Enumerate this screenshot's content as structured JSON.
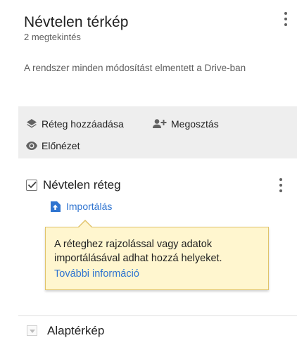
{
  "header": {
    "title": "Névtelen térkép",
    "views": "2 megtekintés",
    "save_status": "A rendszer minden módosítást elmentett a Drive-ban",
    "more_icon": "more-vert-icon"
  },
  "toolbar": {
    "add_layer_label": "Réteg hozzáadása",
    "add_layer_icon": "layers-icon",
    "share_label": "Megosztás",
    "share_icon": "person-add-icon",
    "preview_label": "Előnézet",
    "preview_icon": "eye-icon"
  },
  "layer": {
    "name": "Névtelen réteg",
    "checked": true,
    "import_label": "Importálás",
    "import_icon": "upload-file-icon",
    "more_icon": "more-vert-icon"
  },
  "tooltip": {
    "text": "A réteghez rajzolással vagy adatok importálásával adhat hozzá helyeket.",
    "link_label": "További információ"
  },
  "base_map": {
    "label": "Alaptérkép",
    "expand_icon": "triangle-down-icon"
  },
  "colors": {
    "link": "#2f74d0",
    "toolbar_bg": "#eeeeee",
    "tooltip_bg": "#fff6cf",
    "tooltip_border": "#e0c36a"
  }
}
